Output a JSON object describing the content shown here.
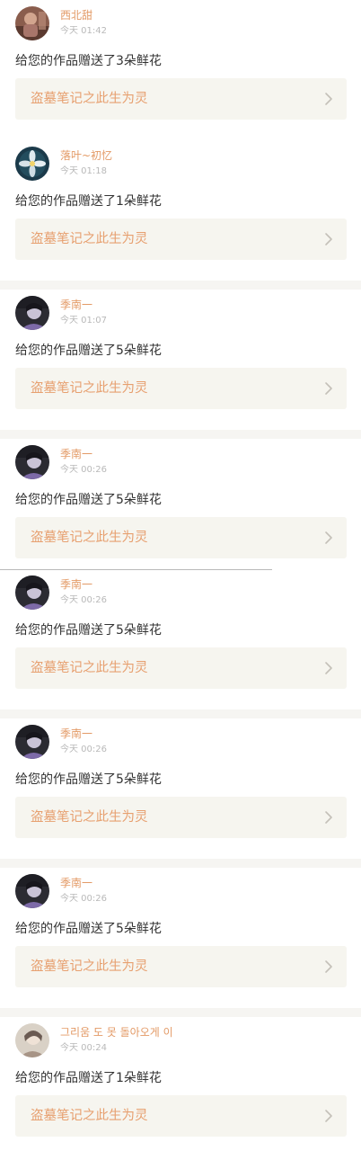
{
  "colors": {
    "name_accent": "#e39a66",
    "work_title": "#e7a070",
    "time_text": "#b9b9b9",
    "message_text": "#333333",
    "card_link_bg": "#f6f5ef",
    "separator_bg": "#f6f5f2"
  },
  "icons": {
    "link_arrow": "chevron-right-icon"
  },
  "notifications": [
    {
      "avatar": "avatar-photo-brown",
      "name": "西北甜",
      "time": "今天 01:42",
      "message": "给您的作品赠送了3朵鲜花",
      "work_title": "盗墓笔记之此生为灵"
    },
    {
      "avatar": "avatar-photo-flower",
      "name": "落叶~初忆",
      "time": "今天 01:18",
      "message": "给您的作品赠送了1朵鲜花",
      "work_title": "盗墓笔记之此生为灵"
    },
    {
      "avatar": "avatar-photo-dark",
      "name": "季南一",
      "time": "今天 01:07",
      "message": "给您的作品赠送了5朵鲜花",
      "work_title": "盗墓笔记之此生为灵"
    },
    {
      "avatar": "avatar-photo-dark",
      "name": "季南一",
      "time": "今天 00:26",
      "message": "给您的作品赠送了5朵鲜花",
      "work_title": "盗墓笔记之此生为灵"
    },
    {
      "avatar": "avatar-photo-dark",
      "name": "季南一",
      "time": "今天 00:26",
      "message": "给您的作品赠送了5朵鲜花",
      "work_title": "盗墓笔记之此生为灵"
    },
    {
      "avatar": "avatar-photo-dark",
      "name": "季南一",
      "time": "今天 00:26",
      "message": "给您的作品赠送了5朵鲜花",
      "work_title": "盗墓笔记之此生为灵"
    },
    {
      "avatar": "avatar-photo-dark",
      "name": "季南一",
      "time": "今天 00:26",
      "message": "给您的作品赠送了5朵鲜花",
      "work_title": "盗墓笔记之此生为灵"
    },
    {
      "avatar": "avatar-photo-light",
      "name": "그리움 도 못 돌아오게 이",
      "time": "今天 00:24",
      "message": "给您的作品赠送了1朵鲜花",
      "work_title": "盗墓笔记之此生为灵"
    }
  ]
}
